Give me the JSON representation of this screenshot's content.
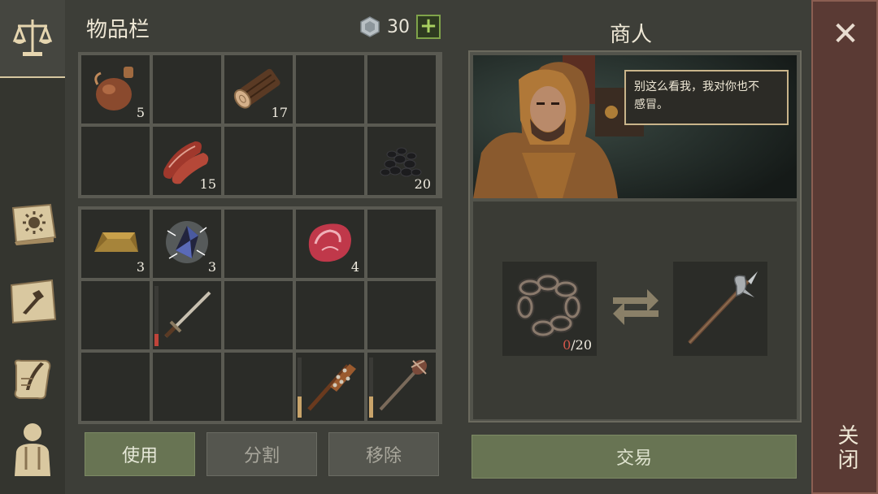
{
  "inventory": {
    "title": "物品栏",
    "coins": "30",
    "add_label": "+",
    "slots_top": [
      {
        "icon": "flask-icon",
        "count": "5"
      },
      {
        "icon": "",
        "count": ""
      },
      {
        "icon": "log-icon",
        "count": "17"
      },
      {
        "icon": "",
        "count": ""
      },
      {
        "icon": "",
        "count": ""
      },
      {
        "icon": "",
        "count": ""
      },
      {
        "icon": "raw-meat-strips-icon",
        "count": "15"
      },
      {
        "icon": "",
        "count": ""
      },
      {
        "icon": "",
        "count": ""
      },
      {
        "icon": "coal-icon",
        "count": "20"
      }
    ],
    "slots_bottom": [
      {
        "icon": "gold-ingot-icon",
        "count": "3"
      },
      {
        "icon": "crystal-icon",
        "count": "3"
      },
      {
        "icon": "",
        "count": ""
      },
      {
        "icon": "steak-icon",
        "count": "4"
      },
      {
        "icon": "",
        "count": ""
      },
      {
        "icon": "",
        "count": ""
      },
      {
        "icon": "sword-icon",
        "count": "",
        "durability": 0.2
      },
      {
        "icon": "",
        "count": ""
      },
      {
        "icon": "",
        "count": ""
      },
      {
        "icon": "",
        "count": ""
      },
      {
        "icon": "",
        "count": ""
      },
      {
        "icon": "",
        "count": ""
      },
      {
        "icon": "",
        "count": ""
      },
      {
        "icon": "spiked-club-icon",
        "count": "",
        "durability": 0.35
      },
      {
        "icon": "mace-icon",
        "count": "",
        "durability": 0.35
      }
    ],
    "buttons": {
      "use": "使用",
      "split": "分割",
      "remove": "移除"
    }
  },
  "merchant": {
    "title": "商人",
    "speech_line1": "别这么看我，我对你也不",
    "speech_line2": "感冒。",
    "trade_give_have": "0",
    "trade_give_need": "/20",
    "trade_button": "交易"
  },
  "close": {
    "label": "关闭"
  },
  "colors": {
    "accent_green": "#687453",
    "durability_red": "#c0443a",
    "durability_tan": "#c9a46a"
  }
}
